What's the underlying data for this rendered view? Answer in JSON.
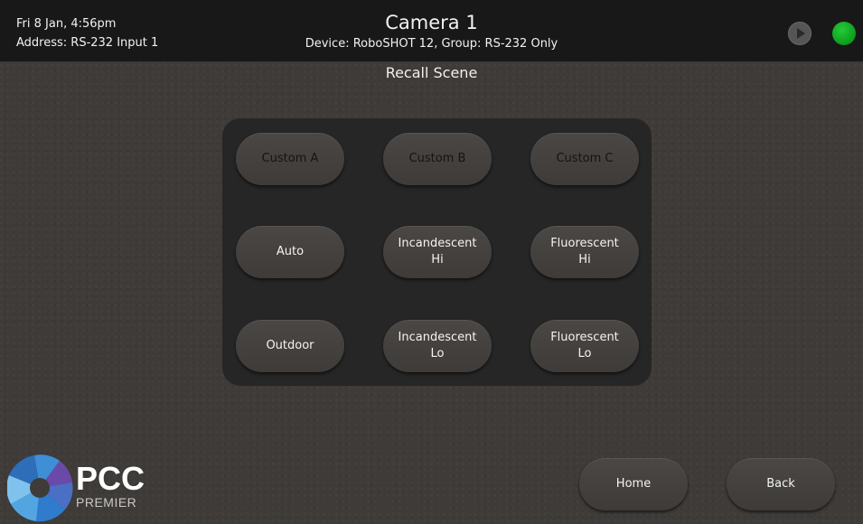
{
  "header": {
    "datetime": "Fri 8 Jan, 4:56pm",
    "address": "Address: RS-232 Input 1",
    "title": "Camera 1",
    "subtitle": "Device: RoboSHOT 12, Group: RS-232 Only",
    "play_icon": "play-icon",
    "status_icon": "status-indicator",
    "status_color": "#1bb52c"
  },
  "page_title": "Recall Scene",
  "scenes": [
    {
      "label": "Custom A"
    },
    {
      "label": "Custom B"
    },
    {
      "label": "Custom C"
    },
    {
      "label": "Auto"
    },
    {
      "label": "Incandescent\nHi"
    },
    {
      "label": "Fluorescent\nHi"
    },
    {
      "label": "Outdoor"
    },
    {
      "label": "Incandescent\nLo"
    },
    {
      "label": "Fluorescent\nLo"
    }
  ],
  "nav": {
    "home_label": "Home",
    "back_label": "Back"
  },
  "logo": {
    "name": "PCC",
    "tagline": "PREMIER"
  }
}
